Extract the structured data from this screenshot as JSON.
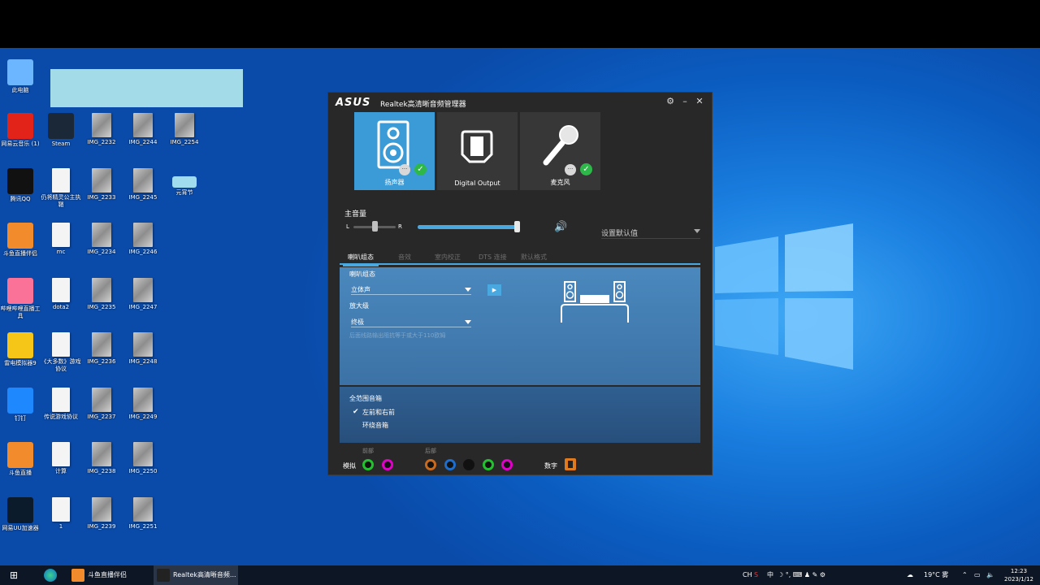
{
  "desktop": {
    "icons": [
      {
        "label": "此电脑",
        "name": "this-pc",
        "color": "#6bb6ff"
      },
      {
        "label": "网易云音乐\n(1)",
        "name": "netease-music",
        "color": "#e2231a"
      },
      {
        "label": "Steam",
        "name": "steam",
        "color": "#1b2838"
      },
      {
        "label": "IMG_2232",
        "name": "img-2232",
        "kind": "img"
      },
      {
        "label": "IMG_2244",
        "name": "img-2244",
        "kind": "img"
      },
      {
        "label": "IMG_2254",
        "name": "img-2254",
        "kind": "img"
      },
      {
        "label": "腾讯QQ",
        "name": "qq",
        "color": "#111111"
      },
      {
        "label": "仍将精灵公主执鞘",
        "name": "doc-1",
        "kind": "doc"
      },
      {
        "label": "IMG_2233",
        "name": "img-2233",
        "kind": "img"
      },
      {
        "label": "IMG_2245",
        "name": "img-2245",
        "kind": "img"
      },
      {
        "label": "元宵节",
        "name": "folder-yuanxiao",
        "kind": "folder"
      },
      {
        "label": "斗鱼直播伴侣",
        "name": "douyu-companion",
        "color": "#f28b2c"
      },
      {
        "label": "mc",
        "name": "doc-mc",
        "kind": "doc"
      },
      {
        "label": "IMG_2234",
        "name": "img-2234",
        "kind": "img"
      },
      {
        "label": "IMG_2246",
        "name": "img-2246",
        "kind": "img"
      },
      {
        "label": "哔哩哔哩直播工具",
        "name": "bilibili-live",
        "color": "#fb7299"
      },
      {
        "label": "dota2",
        "name": "doc-dota2",
        "kind": "doc"
      },
      {
        "label": "IMG_2235",
        "name": "img-2235",
        "kind": "img"
      },
      {
        "label": "IMG_2247",
        "name": "img-2247",
        "kind": "img"
      },
      {
        "label": "雷电模拟器9",
        "name": "ldplayer",
        "color": "#f5c518"
      },
      {
        "label": "《大多数》游戏协议",
        "name": "doc-agreement",
        "kind": "doc"
      },
      {
        "label": "IMG_2236",
        "name": "img-2236",
        "kind": "img"
      },
      {
        "label": "IMG_2248",
        "name": "img-2248",
        "kind": "img"
      },
      {
        "label": "钉钉",
        "name": "dingtalk",
        "color": "#1e88ff"
      },
      {
        "label": "传说游戏协议",
        "name": "doc-protocol",
        "kind": "doc"
      },
      {
        "label": "IMG_2237",
        "name": "img-2237",
        "kind": "img"
      },
      {
        "label": "IMG_2249",
        "name": "img-2249",
        "kind": "img"
      },
      {
        "label": "斗鱼直播",
        "name": "douyu-live",
        "color": "#f28b2c"
      },
      {
        "label": "计算",
        "name": "doc-calc",
        "kind": "doc"
      },
      {
        "label": "IMG_2238",
        "name": "img-2238",
        "kind": "img"
      },
      {
        "label": "IMG_2250",
        "name": "img-2250",
        "kind": "img"
      },
      {
        "label": "网易UU加速器",
        "name": "uu-accelerator",
        "color": "#0b1b2b"
      },
      {
        "label": "1",
        "name": "doc-1b",
        "kind": "doc"
      },
      {
        "label": "IMG_2239",
        "name": "img-2239",
        "kind": "img"
      },
      {
        "label": "IMG_2251",
        "name": "img-2251",
        "kind": "img"
      }
    ]
  },
  "realtek": {
    "brand": "ASUS",
    "title": "Realtek高清晰音频管理器",
    "devices": [
      {
        "label": "扬声器"
      },
      {
        "label": "Digital Output"
      },
      {
        "label": "麦克风"
      }
    ],
    "main_volume_label": "主音量",
    "balance_left": "L",
    "balance_right": "R",
    "main_volume_fraction": 0.98,
    "balance_fraction": 0.5,
    "default_device_label": "设置默认值",
    "tabs": [
      "喇叭组态",
      "音效",
      "室内校正",
      "DTS 连接",
      "默认格式"
    ],
    "speaker_config": {
      "title": "喇叭组态",
      "config_value": "立体声",
      "amp_label": "放大级",
      "amp_value": "终极",
      "hint": "后面线路输出阻抗等于或大于110欧姆"
    },
    "fullrange": {
      "title": "全范围音箱",
      "opt1": "左前和右前",
      "opt1_checked": true,
      "opt2": "环绕音箱",
      "opt2_checked": false
    },
    "jacks": {
      "front_label": "前部",
      "rear_label": "后部",
      "analog_label": "模拟",
      "digital_label": "数字",
      "colors": {
        "green": "#22c22e",
        "pink": "#e000c8",
        "orange": "#c86a1e",
        "blue": "#1d6dcc",
        "black": "#111111"
      }
    }
  },
  "taskbar": {
    "items": [
      {
        "label": "斗鱼直播伴侣"
      },
      {
        "label": "Realtek高清晰音频..."
      }
    ],
    "tray": {
      "ime": "CH",
      "ime2": "中",
      "weather": "19°C 雾",
      "time": "12:23",
      "date": "2023/1/12"
    }
  }
}
